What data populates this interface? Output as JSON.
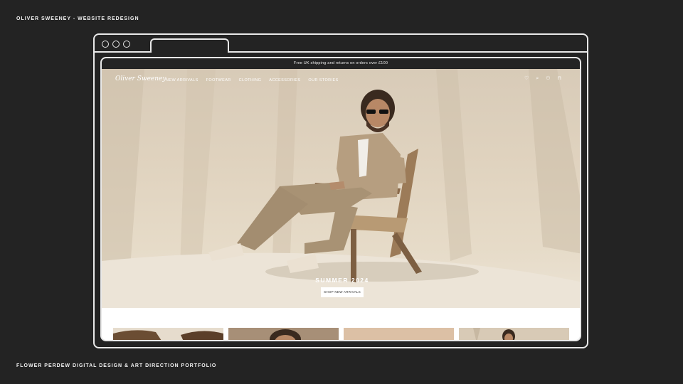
{
  "captions": {
    "top": "OLIVER SWEENEY - WEBSITE REDESIGN",
    "bottom": "FLOWER PERDEW DIGITAL DESIGN & ART DIRECTION PORTFOLIO"
  },
  "site": {
    "promo": "Free UK shipping and returns on orders over £100",
    "logo": "Oliver Sweeney",
    "menu": [
      "NEW ARRIVALS",
      "FOOTWEAR",
      "CLOTHING",
      "ACCESSORIES",
      "OUR STORIES"
    ],
    "icons": [
      "heart-icon",
      "search-icon",
      "account-icon",
      "bag-icon"
    ],
    "hero_title": "SUMMER 2024",
    "hero_button": "SHOP NEW ARRIVALS"
  },
  "colors": {
    "background": "#232323",
    "frame": "#e9e9e9",
    "hero_backdrop": "#ddd0bc"
  }
}
